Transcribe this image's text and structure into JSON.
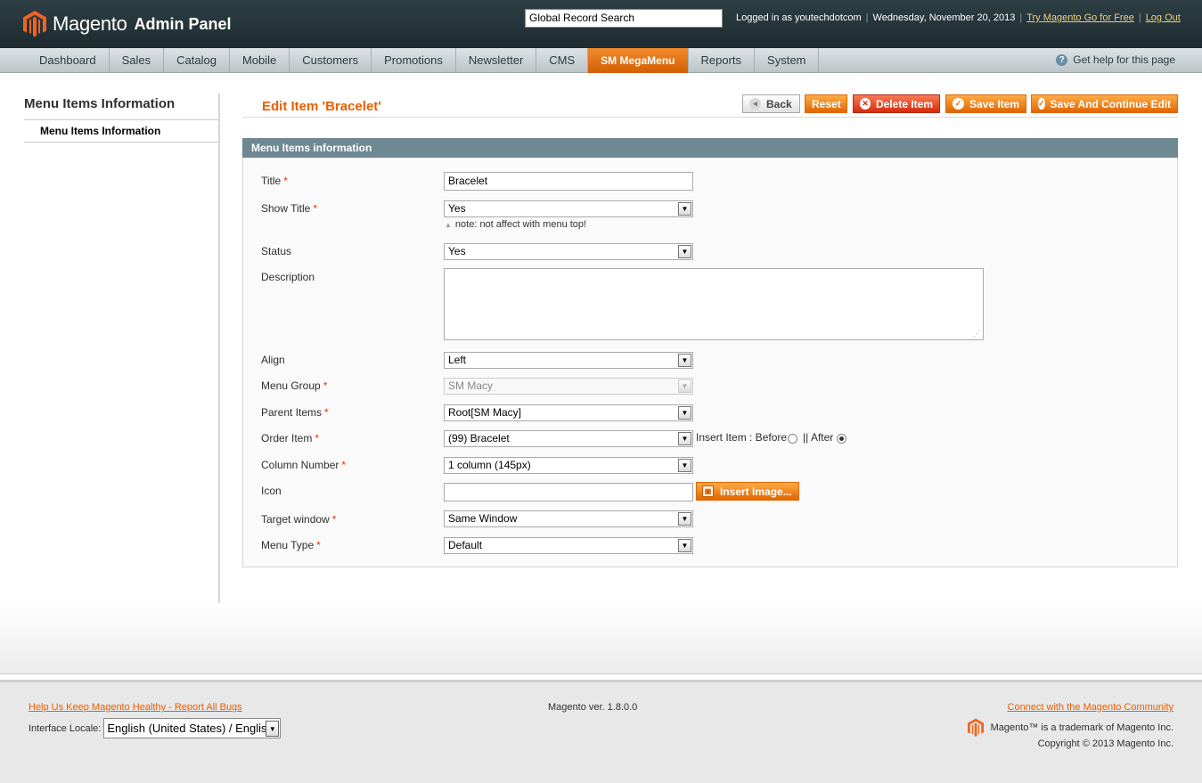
{
  "header": {
    "logo_text": "Magento",
    "logo_sub": "Admin Panel",
    "search_value": "Global Record Search",
    "logged_in": "Logged in as youtechdotcom",
    "date": "Wednesday, November 20, 2013",
    "try_link": "Try Magento Go for Free",
    "logout_link": "Log Out"
  },
  "nav": {
    "items": [
      "Dashboard",
      "Sales",
      "Catalog",
      "Mobile",
      "Customers",
      "Promotions",
      "Newsletter",
      "CMS",
      "SM MegaMenu",
      "Reports",
      "System"
    ],
    "active": "SM MegaMenu",
    "help": "Get help for this page"
  },
  "sidebar": {
    "title": "Menu Items Information",
    "items": [
      {
        "label": "Menu Items Information"
      }
    ]
  },
  "page": {
    "title": "Edit Item 'Bracelet'",
    "buttons": {
      "back": "Back",
      "reset": "Reset",
      "delete": "Delete Item",
      "save": "Save Item",
      "save_continue": "Save And Continue Edit"
    }
  },
  "form": {
    "legend": "Menu Items information",
    "title": {
      "label": "Title",
      "value": "Bracelet"
    },
    "show_title": {
      "label": "Show Title",
      "value": "Yes",
      "note": "note: not affect with menu top!"
    },
    "status": {
      "label": "Status",
      "value": "Yes"
    },
    "description": {
      "label": "Description",
      "value": ""
    },
    "align": {
      "label": "Align",
      "value": "Left"
    },
    "menu_group": {
      "label": "Menu Group",
      "value": "SM Macy"
    },
    "parent_items": {
      "label": "Parent Items",
      "value": "Root[SM Macy]"
    },
    "order_item": {
      "label": "Order Item",
      "value": "(99) Bracelet",
      "insert_label": "Insert Item : Before",
      "after_label": "|| After",
      "selected": "After"
    },
    "column_number": {
      "label": "Column Number",
      "value": "1 column (145px)"
    },
    "icon": {
      "label": "Icon",
      "value": "",
      "button": "Insert Image..."
    },
    "target_window": {
      "label": "Target window",
      "value": "Same Window"
    },
    "menu_type": {
      "label": "Menu Type",
      "value": "Default"
    }
  },
  "footer": {
    "bugs_link": "Help Us Keep Magento Healthy - Report All Bugs",
    "locale_label": "Interface Locale:",
    "locale_value": "English (United States) / English",
    "version": "Magento ver. 1.8.0.0",
    "community_link": "Connect with the Magento Community",
    "trademark": "Magento™ is a trademark of Magento Inc.",
    "copyright": "Copyright © 2013 Magento Inc."
  },
  "colors": {
    "accent": "#eb5e00",
    "header_bg": "#2e3f45",
    "fieldset_head": "#6f8992"
  }
}
